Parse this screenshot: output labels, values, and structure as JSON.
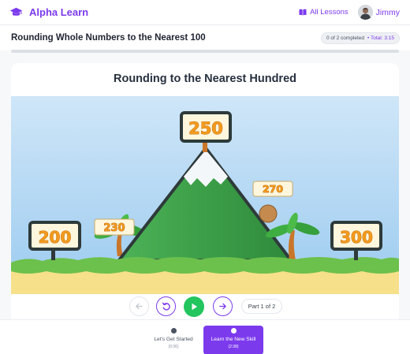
{
  "app": {
    "name": "Alpha Learn",
    "all_lessons_label": "All Lessons",
    "user_name": "Jimmy"
  },
  "lesson": {
    "title": "Rounding Whole Numbers to the Nearest 100",
    "progress_text": "0 of 2 completed",
    "total_text": "• Total: 3:15",
    "progress_fraction": 0
  },
  "stage": {
    "title": "Rounding to the Nearest Hundred",
    "signs": {
      "left": "200",
      "peak": "250",
      "right": "300",
      "ball_left": "230",
      "ball_right": "270"
    }
  },
  "controls": {
    "part_label": "Part 1 of 2"
  },
  "segments": [
    {
      "label": "Let's Get Started",
      "time": "(0:36)",
      "active": false
    },
    {
      "label": "Learn the New Skill",
      "time": "(2:38)",
      "active": true
    }
  ],
  "colors": {
    "accent": "#7c3aed",
    "play": "#22c55e",
    "mountain": "#3fa24a",
    "sky": "#a9d3f2",
    "sign_text": "#f39b1e"
  }
}
